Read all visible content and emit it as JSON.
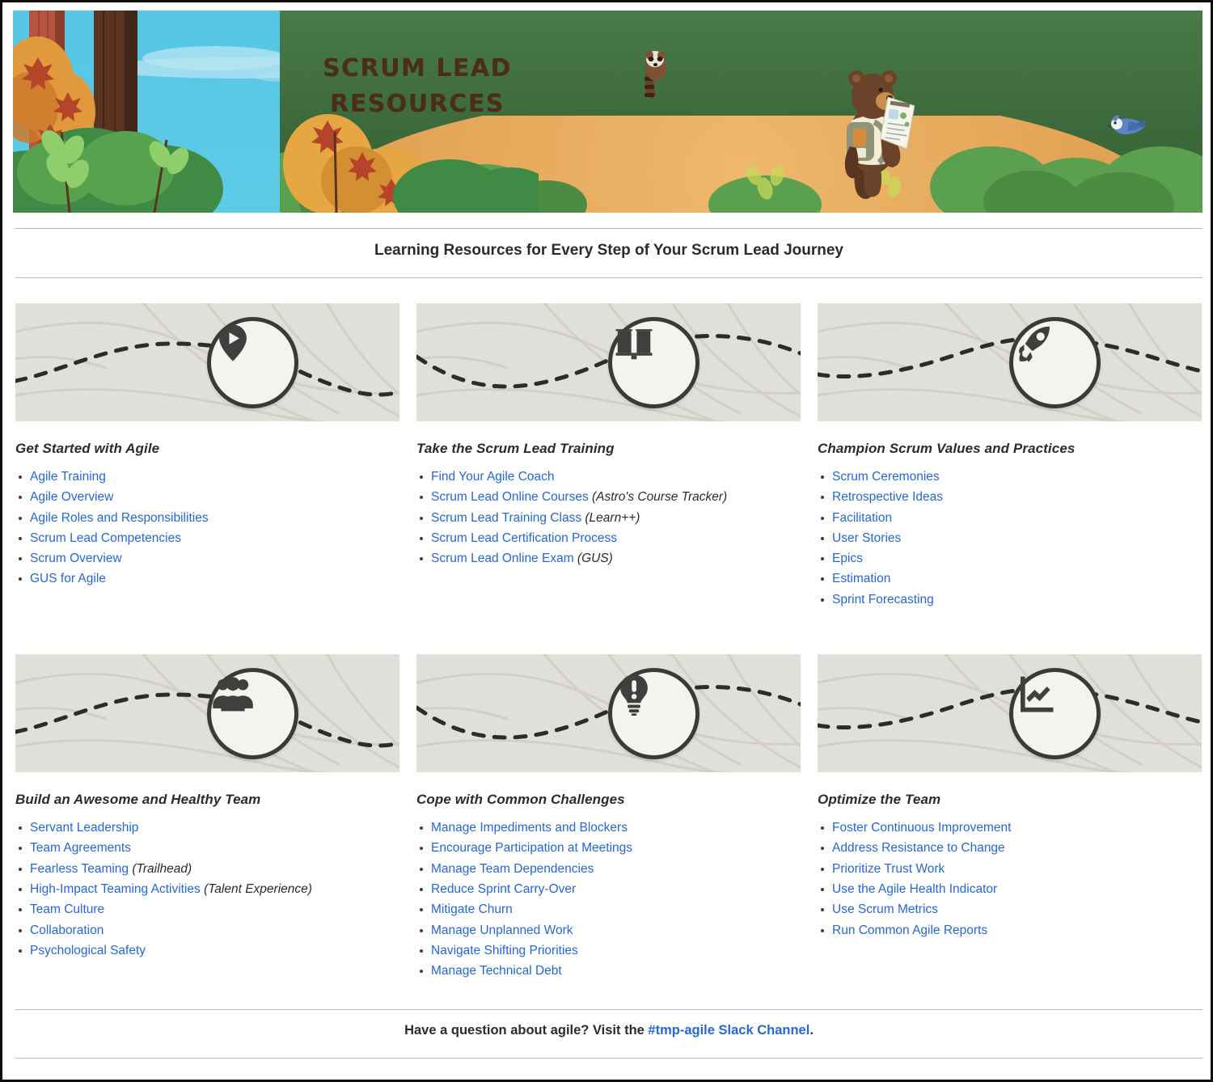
{
  "banner": {
    "title_line1": "SCRUM LEAD",
    "title_line2": "RESOURCES",
    "scene_alt": "Illustrated forest with a hiking bear reading a trail map, a raccoon on a tree, and a blue jay"
  },
  "header": {
    "heading": "Learning Resources for Every Step of Your Scrum Lead Journey"
  },
  "colors": {
    "link": "#2566d8",
    "text": "#2b2b2b",
    "card_band": "#e1dfda",
    "banner_title": "#4b2d18",
    "sky": "#55c6e4",
    "path": "#e7a95a"
  },
  "sections": [
    {
      "icon": "location-pin-play-icon",
      "title": "Get Started with Agile",
      "links": [
        {
          "label": "Agile Training",
          "note": ""
        },
        {
          "label": "Agile Overview",
          "note": ""
        },
        {
          "label": "Agile Roles and Responsibilities",
          "note": ""
        },
        {
          "label": "Scrum Lead Competencies",
          "note": ""
        },
        {
          "label": "Scrum Overview",
          "note": ""
        },
        {
          "label": "GUS for Agile",
          "note": ""
        }
      ]
    },
    {
      "icon": "open-book-icon",
      "title": "Take the Scrum Lead Training",
      "links": [
        {
          "label": "Find Your Agile Coach",
          "note": ""
        },
        {
          "label": "Scrum Lead Online Courses",
          "note": "(Astro's Course Tracker)"
        },
        {
          "label": "Scrum Lead Training Class",
          "note": "(Learn++)"
        },
        {
          "label": "Scrum Lead Certification Process",
          "note": ""
        },
        {
          "label": "Scrum Lead Online Exam",
          "note": "(GUS)"
        }
      ]
    },
    {
      "icon": "rocket-icon",
      "title": "Champion Scrum Values and Practices",
      "links": [
        {
          "label": "Scrum Ceremonies",
          "note": ""
        },
        {
          "label": "Retrospective Ideas",
          "note": ""
        },
        {
          "label": "Facilitation",
          "note": ""
        },
        {
          "label": "User Stories",
          "note": ""
        },
        {
          "label": "Epics",
          "note": ""
        },
        {
          "label": "Estimation",
          "note": ""
        },
        {
          "label": "Sprint Forecasting",
          "note": ""
        }
      ]
    },
    {
      "icon": "people-group-icon",
      "title": "Build an Awesome and Healthy Team",
      "links": [
        {
          "label": "Servant Leadership",
          "note": ""
        },
        {
          "label": "Team Agreements",
          "note": ""
        },
        {
          "label": "Fearless Teaming",
          "note": "(Trailhead)"
        },
        {
          "label": "High-Impact Teaming Activities",
          "note": "(Talent Experience)"
        },
        {
          "label": "Team Culture",
          "note": ""
        },
        {
          "label": "Collaboration",
          "note": ""
        },
        {
          "label": "Psychological Safety",
          "note": ""
        }
      ]
    },
    {
      "icon": "lightbulb-exclamation-icon",
      "title": "Cope with Common Challenges",
      "links": [
        {
          "label": "Manage Impediments and Blockers",
          "note": ""
        },
        {
          "label": "Encourage Participation at Meetings",
          "note": ""
        },
        {
          "label": "Manage Team Dependencies",
          "note": ""
        },
        {
          "label": "Reduce Sprint Carry-Over",
          "note": ""
        },
        {
          "label": "Mitigate Churn",
          "note": ""
        },
        {
          "label": "Manage Unplanned Work",
          "note": ""
        },
        {
          "label": "Navigate Shifting Priorities",
          "note": ""
        },
        {
          "label": "Manage Technical Debt",
          "note": ""
        }
      ]
    },
    {
      "icon": "line-chart-icon",
      "title": "Optimize the Team",
      "links": [
        {
          "label": "Foster Continuous Improvement",
          "note": ""
        },
        {
          "label": "Address Resistance to Change",
          "note": ""
        },
        {
          "label": "Prioritize Trust Work",
          "note": ""
        },
        {
          "label": "Use the Agile Health Indicator",
          "note": ""
        },
        {
          "label": "Use Scrum Metrics",
          "note": ""
        },
        {
          "label": "Run Common Agile Reports",
          "note": ""
        }
      ]
    }
  ],
  "footer": {
    "prefix": "Have a question about agile? Visit the ",
    "link": "#tmp-agile Slack Channel",
    "suffix": "."
  }
}
